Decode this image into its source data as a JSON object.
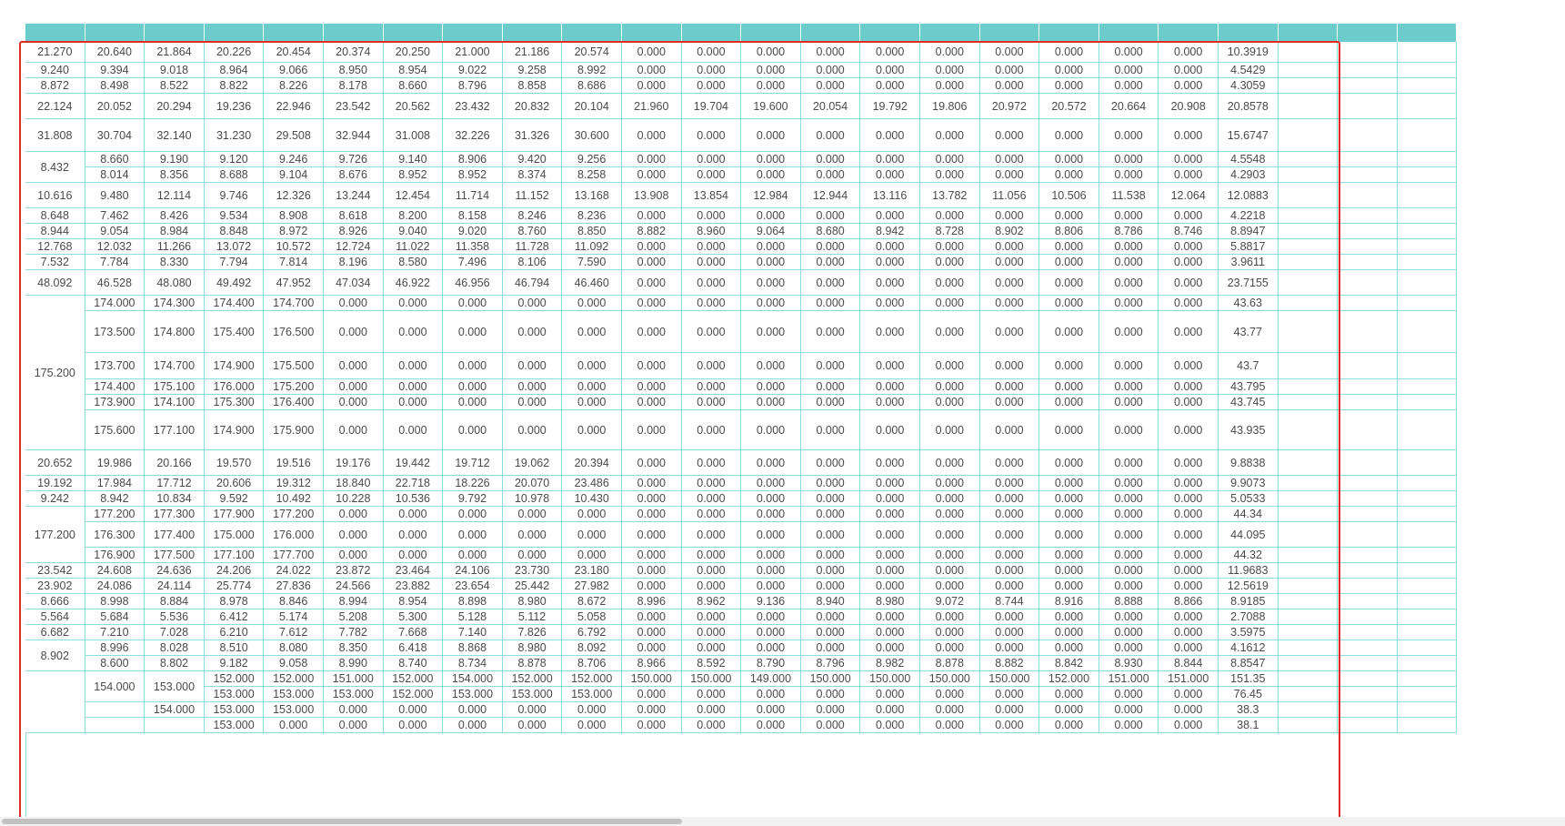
{
  "table": {
    "columns": 24,
    "rows": [
      [
        "21.270",
        "20.640",
        "21.864",
        "20.226",
        "20.454",
        "20.374",
        "20.250",
        "21.000",
        "21.186",
        "20.574",
        "0.000",
        "0.000",
        "0.000",
        "0.000",
        "0.000",
        "0.000",
        "0.000",
        "0.000",
        "0.000",
        "0.000",
        "10.3919"
      ],
      [
        "9.240",
        "9.394",
        "9.018",
        "8.964",
        "9.066",
        "8.950",
        "8.954",
        "9.022",
        "9.258",
        "8.992",
        "0.000",
        "0.000",
        "0.000",
        "0.000",
        "0.000",
        "0.000",
        "0.000",
        "0.000",
        "0.000",
        "0.000",
        "4.5429"
      ],
      [
        "8.872",
        "8.498",
        "8.522",
        "8.822",
        "8.226",
        "8.178",
        "8.660",
        "8.796",
        "8.858",
        "8.686",
        "0.000",
        "0.000",
        "0.000",
        "0.000",
        "0.000",
        "0.000",
        "0.000",
        "0.000",
        "0.000",
        "0.000",
        "4.3059"
      ],
      [
        "22.124",
        "20.052",
        "20.294",
        "19.236",
        "22.946",
        "23.542",
        "20.562",
        "23.432",
        "20.832",
        "20.104",
        "21.960",
        "19.704",
        "19.600",
        "20.054",
        "19.792",
        "19.806",
        "20.972",
        "20.572",
        "20.664",
        "20.908",
        "20.8578"
      ],
      [
        "31.808",
        "30.704",
        "32.140",
        "31.230",
        "29.508",
        "32.944",
        "31.008",
        "32.226",
        "31.326",
        "30.600",
        "0.000",
        "0.000",
        "0.000",
        "0.000",
        "0.000",
        "0.000",
        "0.000",
        "0.000",
        "0.000",
        "0.000",
        "15.6747"
      ],
      [
        "8.432",
        "8.660",
        "9.190",
        "9.120",
        "9.246",
        "9.726",
        "9.140",
        "8.906",
        "9.420",
        "9.256",
        "0.000",
        "0.000",
        "0.000",
        "0.000",
        "0.000",
        "0.000",
        "0.000",
        "0.000",
        "0.000",
        "0.000",
        "4.5548"
      ],
      [
        "",
        "8.014",
        "8.356",
        "8.688",
        "9.104",
        "8.676",
        "8.952",
        "8.952",
        "8.374",
        "8.258",
        "0.000",
        "0.000",
        "0.000",
        "0.000",
        "0.000",
        "0.000",
        "0.000",
        "0.000",
        "0.000",
        "0.000",
        "4.2903"
      ],
      [
        "10.616",
        "9.480",
        "12.114",
        "9.746",
        "12.326",
        "13.244",
        "12.454",
        "11.714",
        "11.152",
        "13.168",
        "13.908",
        "13.854",
        "12.984",
        "12.944",
        "13.116",
        "13.782",
        "11.056",
        "10.506",
        "11.538",
        "12.064",
        "12.0883"
      ],
      [
        "8.648",
        "7.462",
        "8.426",
        "9.534",
        "8.908",
        "8.618",
        "8.200",
        "8.158",
        "8.246",
        "8.236",
        "0.000",
        "0.000",
        "0.000",
        "0.000",
        "0.000",
        "0.000",
        "0.000",
        "0.000",
        "0.000",
        "0.000",
        "4.2218"
      ],
      [
        "8.944",
        "9.054",
        "8.984",
        "8.848",
        "8.972",
        "8.926",
        "9.040",
        "9.020",
        "8.760",
        "8.850",
        "8.882",
        "8.960",
        "9.064",
        "8.680",
        "8.942",
        "8.728",
        "8.902",
        "8.806",
        "8.786",
        "8.746",
        "8.8947"
      ],
      [
        "12.768",
        "12.032",
        "11.266",
        "13.072",
        "10.572",
        "12.724",
        "11.022",
        "11.358",
        "11.728",
        "11.092",
        "0.000",
        "0.000",
        "0.000",
        "0.000",
        "0.000",
        "0.000",
        "0.000",
        "0.000",
        "0.000",
        "0.000",
        "5.8817"
      ],
      [
        "7.532",
        "7.784",
        "8.330",
        "7.794",
        "7.814",
        "8.196",
        "8.580",
        "7.496",
        "8.106",
        "7.590",
        "0.000",
        "0.000",
        "0.000",
        "0.000",
        "0.000",
        "0.000",
        "0.000",
        "0.000",
        "0.000",
        "0.000",
        "3.9611"
      ],
      [
        "48.092",
        "46.528",
        "48.080",
        "49.492",
        "47.952",
        "47.034",
        "46.922",
        "46.956",
        "46.794",
        "46.460",
        "0.000",
        "0.000",
        "0.000",
        "0.000",
        "0.000",
        "0.000",
        "0.000",
        "0.000",
        "0.000",
        "0.000",
        "23.7155"
      ],
      [
        "175.200",
        "174.000",
        "174.300",
        "174.400",
        "174.700",
        "0.000",
        "0.000",
        "0.000",
        "0.000",
        "0.000",
        "0.000",
        "0.000",
        "0.000",
        "0.000",
        "0.000",
        "0.000",
        "0.000",
        "0.000",
        "0.000",
        "0.000",
        "43.63"
      ],
      [
        "",
        "173.500",
        "174.800",
        "175.400",
        "176.500",
        "0.000",
        "0.000",
        "0.000",
        "0.000",
        "0.000",
        "0.000",
        "0.000",
        "0.000",
        "0.000",
        "0.000",
        "0.000",
        "0.000",
        "0.000",
        "0.000",
        "0.000",
        "43.77"
      ],
      [
        "",
        "173.700",
        "174.700",
        "174.900",
        "175.500",
        "0.000",
        "0.000",
        "0.000",
        "0.000",
        "0.000",
        "0.000",
        "0.000",
        "0.000",
        "0.000",
        "0.000",
        "0.000",
        "0.000",
        "0.000",
        "0.000",
        "0.000",
        "43.7"
      ],
      [
        "",
        "174.400",
        "175.100",
        "176.000",
        "175.200",
        "0.000",
        "0.000",
        "0.000",
        "0.000",
        "0.000",
        "0.000",
        "0.000",
        "0.000",
        "0.000",
        "0.000",
        "0.000",
        "0.000",
        "0.000",
        "0.000",
        "0.000",
        "43.795"
      ],
      [
        "",
        "173.900",
        "174.100",
        "175.300",
        "176.400",
        "0.000",
        "0.000",
        "0.000",
        "0.000",
        "0.000",
        "0.000",
        "0.000",
        "0.000",
        "0.000",
        "0.000",
        "0.000",
        "0.000",
        "0.000",
        "0.000",
        "0.000",
        "43.745"
      ],
      [
        "",
        "175.600",
        "177.100",
        "174.900",
        "175.900",
        "0.000",
        "0.000",
        "0.000",
        "0.000",
        "0.000",
        "0.000",
        "0.000",
        "0.000",
        "0.000",
        "0.000",
        "0.000",
        "0.000",
        "0.000",
        "0.000",
        "0.000",
        "43.935"
      ],
      [
        "20.652",
        "19.986",
        "20.166",
        "19.570",
        "19.516",
        "19.176",
        "19.442",
        "19.712",
        "19.062",
        "20.394",
        "0.000",
        "0.000",
        "0.000",
        "0.000",
        "0.000",
        "0.000",
        "0.000",
        "0.000",
        "0.000",
        "0.000",
        "9.8838"
      ],
      [
        "19.192",
        "17.984",
        "17.712",
        "20.606",
        "19.312",
        "18.840",
        "22.718",
        "18.226",
        "20.070",
        "23.486",
        "0.000",
        "0.000",
        "0.000",
        "0.000",
        "0.000",
        "0.000",
        "0.000",
        "0.000",
        "0.000",
        "0.000",
        "9.9073"
      ],
      [
        "9.242",
        "8.942",
        "10.834",
        "9.592",
        "10.492",
        "10.228",
        "10.536",
        "9.792",
        "10.978",
        "10.430",
        "0.000",
        "0.000",
        "0.000",
        "0.000",
        "0.000",
        "0.000",
        "0.000",
        "0.000",
        "0.000",
        "0.000",
        "5.0533"
      ],
      [
        "177.200",
        "177.200",
        "177.300",
        "177.900",
        "177.200",
        "0.000",
        "0.000",
        "0.000",
        "0.000",
        "0.000",
        "0.000",
        "0.000",
        "0.000",
        "0.000",
        "0.000",
        "0.000",
        "0.000",
        "0.000",
        "0.000",
        "0.000",
        "44.34"
      ],
      [
        "",
        "176.300",
        "177.400",
        "175.000",
        "176.000",
        "0.000",
        "0.000",
        "0.000",
        "0.000",
        "0.000",
        "0.000",
        "0.000",
        "0.000",
        "0.000",
        "0.000",
        "0.000",
        "0.000",
        "0.000",
        "0.000",
        "0.000",
        "44.095"
      ],
      [
        "",
        "176.900",
        "177.500",
        "177.100",
        "177.700",
        "0.000",
        "0.000",
        "0.000",
        "0.000",
        "0.000",
        "0.000",
        "0.000",
        "0.000",
        "0.000",
        "0.000",
        "0.000",
        "0.000",
        "0.000",
        "0.000",
        "0.000",
        "44.32"
      ],
      [
        "23.542",
        "24.608",
        "24.636",
        "24.206",
        "24.022",
        "23.872",
        "23.464",
        "24.106",
        "23.730",
        "23.180",
        "0.000",
        "0.000",
        "0.000",
        "0.000",
        "0.000",
        "0.000",
        "0.000",
        "0.000",
        "0.000",
        "0.000",
        "11.9683"
      ],
      [
        "23.902",
        "24.086",
        "24.114",
        "25.774",
        "27.836",
        "24.566",
        "23.882",
        "23.654",
        "25.442",
        "27.982",
        "0.000",
        "0.000",
        "0.000",
        "0.000",
        "0.000",
        "0.000",
        "0.000",
        "0.000",
        "0.000",
        "0.000",
        "12.5619"
      ],
      [
        "8.666",
        "8.998",
        "8.884",
        "8.978",
        "8.846",
        "8.994",
        "8.954",
        "8.898",
        "8.980",
        "8.672",
        "8.996",
        "8.962",
        "9.136",
        "8.940",
        "8.980",
        "9.072",
        "8.744",
        "8.916",
        "8.888",
        "8.866",
        "8.9185"
      ],
      [
        "5.564",
        "5.684",
        "5.536",
        "6.412",
        "5.174",
        "5.208",
        "5.300",
        "5.128",
        "5.112",
        "5.058",
        "0.000",
        "0.000",
        "0.000",
        "0.000",
        "0.000",
        "0.000",
        "0.000",
        "0.000",
        "0.000",
        "0.000",
        "2.7088"
      ],
      [
        "6.682",
        "7.210",
        "7.028",
        "6.210",
        "7.612",
        "7.782",
        "7.668",
        "7.140",
        "7.826",
        "6.792",
        "0.000",
        "0.000",
        "0.000",
        "0.000",
        "0.000",
        "0.000",
        "0.000",
        "0.000",
        "0.000",
        "0.000",
        "3.5975"
      ],
      [
        "8.902",
        "8.996",
        "8.028",
        "8.510",
        "8.080",
        "8.350",
        "6.418",
        "8.868",
        "8.980",
        "8.092",
        "0.000",
        "0.000",
        "0.000",
        "0.000",
        "0.000",
        "0.000",
        "0.000",
        "0.000",
        "0.000",
        "0.000",
        "4.1612"
      ],
      [
        "",
        "8.600",
        "8.802",
        "9.182",
        "9.058",
        "8.990",
        "8.740",
        "8.734",
        "8.878",
        "8.706",
        "8.966",
        "8.592",
        "8.790",
        "8.796",
        "8.982",
        "8.878",
        "8.882",
        "8.842",
        "8.930",
        "8.844",
        "8.8547"
      ],
      [
        "",
        "154.000",
        "153.000",
        "152.000",
        "152.000",
        "151.000",
        "152.000",
        "154.000",
        "152.000",
        "152.000",
        "150.000",
        "150.000",
        "149.000",
        "150.000",
        "150.000",
        "150.000",
        "150.000",
        "152.000",
        "151.000",
        "151.000",
        "151.35"
      ],
      [
        "",
        "",
        "",
        "153.000",
        "153.000",
        "153.000",
        "152.000",
        "153.000",
        "153.000",
        "153.000",
        "0.000",
        "0.000",
        "0.000",
        "0.000",
        "0.000",
        "0.000",
        "0.000",
        "0.000",
        "0.000",
        "0.000",
        "76.45"
      ],
      [
        "",
        "",
        "154.000",
        "153.000",
        "153.000",
        "0.000",
        "0.000",
        "0.000",
        "0.000",
        "0.000",
        "0.000",
        "0.000",
        "0.000",
        "0.000",
        "0.000",
        "0.000",
        "0.000",
        "0.000",
        "0.000",
        "0.000",
        "38.3"
      ],
      [
        "",
        "",
        "",
        "153.000",
        "0.000",
        "0.000",
        "0.000",
        "0.000",
        "0.000",
        "0.000",
        "0.000",
        "0.000",
        "0.000",
        "0.000",
        "0.000",
        "0.000",
        "0.000",
        "0.000",
        "0.000",
        "0.000",
        "38.1"
      ]
    ]
  }
}
